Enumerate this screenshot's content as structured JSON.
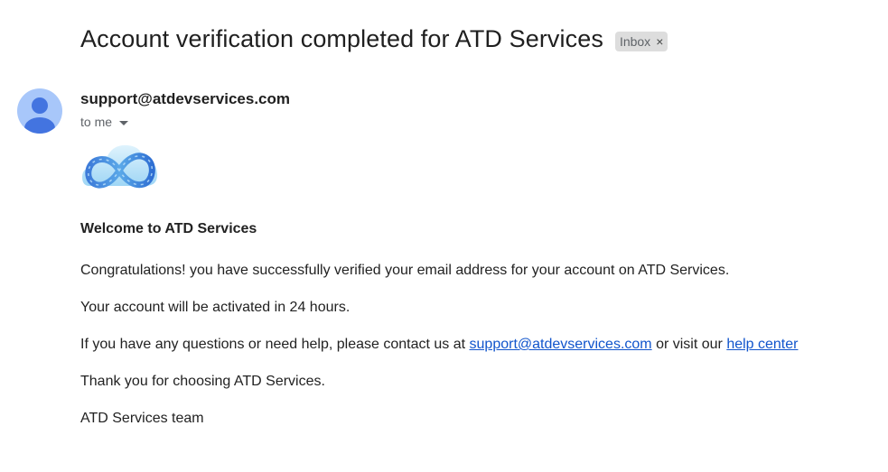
{
  "email": {
    "subject": "Account verification completed for ATD Services",
    "label": "Inbox",
    "label_close": "×",
    "sender": "support@atdevservices.com",
    "recipient": "to me"
  },
  "content": {
    "heading": "Welcome to ATD Services",
    "paragraph1": "Congratulations! you have successfully verified your email address for your account on ATD Services.",
    "paragraph2": "Your account will be activated in 24 hours.",
    "paragraph3_prefix": "If you have any questions or need help, please contact us at ",
    "support_link": "support@atdevservices.com",
    "paragraph3_middle": " or visit our ",
    "help_link": "help center",
    "paragraph4": "Thank you for choosing ATD Services.",
    "signature": "ATD Services team"
  },
  "icons": {
    "avatar": "default-person-avatar-icon",
    "logo": "cloud-infinity-logo",
    "caret": "caret-down-icon"
  },
  "colors": {
    "link": "#1155cc",
    "chip_bg": "#dddddd",
    "avatar_bg": "#a8c7fa",
    "avatar_fg": "#4374e0"
  }
}
